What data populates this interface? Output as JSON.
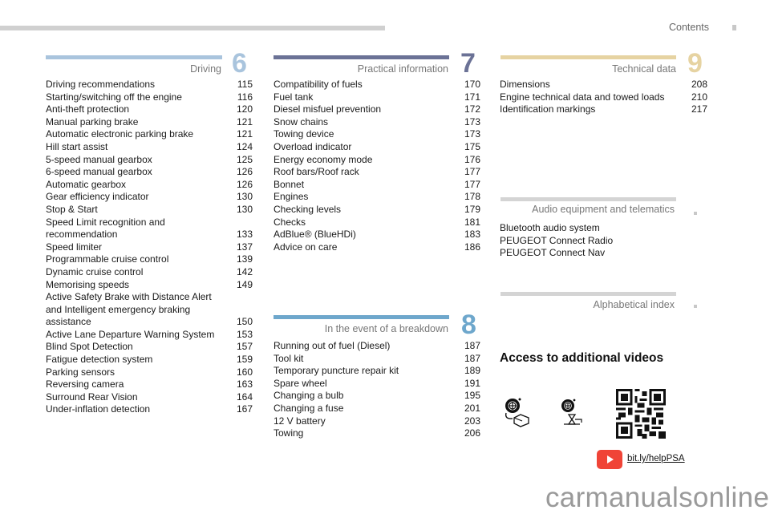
{
  "header": {
    "page_label": "Contents"
  },
  "sections": {
    "driving": {
      "title": "Driving",
      "number": "6",
      "color": "#a9c4dd",
      "items": [
        {
          "label": "Driving recommendations",
          "page": "115"
        },
        {
          "label": "Starting/switching off the engine",
          "page": "116"
        },
        {
          "label": "Anti-theft protection",
          "page": "120"
        },
        {
          "label": "Manual parking brake",
          "page": "121"
        },
        {
          "label": "Automatic electronic parking brake",
          "page": "121"
        },
        {
          "label": "Hill start assist",
          "page": "124"
        },
        {
          "label": "5-speed manual gearbox",
          "page": "125"
        },
        {
          "label": "6-speed manual gearbox",
          "page": "126"
        },
        {
          "label": "Automatic gearbox",
          "page": "126"
        },
        {
          "label": "Gear efficiency indicator",
          "page": "130"
        },
        {
          "label": "Stop & Start",
          "page": "130"
        },
        {
          "label": "Speed Limit recognition and recommendation",
          "page": "133"
        },
        {
          "label": "Speed limiter",
          "page": "137"
        },
        {
          "label": "Programmable cruise control",
          "page": "139"
        },
        {
          "label": "Dynamic cruise control",
          "page": "142"
        },
        {
          "label": "Memorising speeds",
          "page": "149"
        },
        {
          "label": "Active Safety Brake with Distance Alert and Intelligent emergency braking assistance",
          "page": "150"
        },
        {
          "label": "Active Lane Departure Warning System",
          "page": "153"
        },
        {
          "label": "Blind Spot Detection",
          "page": "157"
        },
        {
          "label": "Fatigue detection system",
          "page": "159"
        },
        {
          "label": "Parking sensors",
          "page": "160"
        },
        {
          "label": "Reversing camera",
          "page": "163"
        },
        {
          "label": "Surround Rear Vision",
          "page": "164"
        },
        {
          "label": "Under-inflation detection",
          "page": "167"
        }
      ]
    },
    "practical": {
      "title": "Practical information",
      "number": "7",
      "color": "#6b7296",
      "items": [
        {
          "label": "Compatibility of fuels",
          "page": "170"
        },
        {
          "label": "Fuel tank",
          "page": "171"
        },
        {
          "label": "Diesel misfuel prevention",
          "page": "172"
        },
        {
          "label": "Snow chains",
          "page": "173"
        },
        {
          "label": "Towing device",
          "page": "173"
        },
        {
          "label": "Overload indicator",
          "page": "175"
        },
        {
          "label": "Energy economy mode",
          "page": "176"
        },
        {
          "label": "Roof bars/Roof rack",
          "page": "177"
        },
        {
          "label": "Bonnet",
          "page": "177"
        },
        {
          "label": "Engines",
          "page": "178"
        },
        {
          "label": "Checking levels",
          "page": "179"
        },
        {
          "label": "Checks",
          "page": "181"
        },
        {
          "label": "AdBlue® (BlueHDi)",
          "page": "183"
        },
        {
          "label": "Advice on care",
          "page": "186"
        }
      ]
    },
    "breakdown": {
      "title": "In the event of a breakdown",
      "number": "8",
      "color": "#6ea7cc",
      "items": [
        {
          "label": "Running out of fuel (Diesel)",
          "page": "187"
        },
        {
          "label": "Tool kit",
          "page": "187"
        },
        {
          "label": "Temporary puncture repair kit",
          "page": "189"
        },
        {
          "label": "Spare wheel",
          "page": "191"
        },
        {
          "label": "Changing a bulb",
          "page": "195"
        },
        {
          "label": "Changing a fuse",
          "page": "201"
        },
        {
          "label": "12 V battery",
          "page": "203"
        },
        {
          "label": "Towing",
          "page": "206"
        }
      ]
    },
    "technical": {
      "title": "Technical data",
      "number": "9",
      "color": "#e6d3a2",
      "items": [
        {
          "label": "Dimensions",
          "page": "208"
        },
        {
          "label": "Engine technical data and towed loads",
          "page": "210"
        },
        {
          "label": "Identification markings",
          "page": "217"
        }
      ]
    },
    "audio": {
      "title": "Audio equipment and telematics",
      "color": "#d4d4d4",
      "items": [
        {
          "label": "Bluetooth audio system"
        },
        {
          "label": "PEUGEOT Connect Radio"
        },
        {
          "label": "PEUGEOT Connect Nav"
        }
      ]
    },
    "index": {
      "title": "Alphabetical index",
      "color": "#d4d4d4"
    }
  },
  "videos": {
    "title": "Access to additional videos",
    "icons": [
      "tyre-repair-kit-icon",
      "jack-wheel-change-icon",
      "qr-code-icon"
    ],
    "youtube_icon": "youtube-play-icon",
    "link": "bit.ly/helpPSA"
  },
  "watermark": "carmanualsonline.info"
}
